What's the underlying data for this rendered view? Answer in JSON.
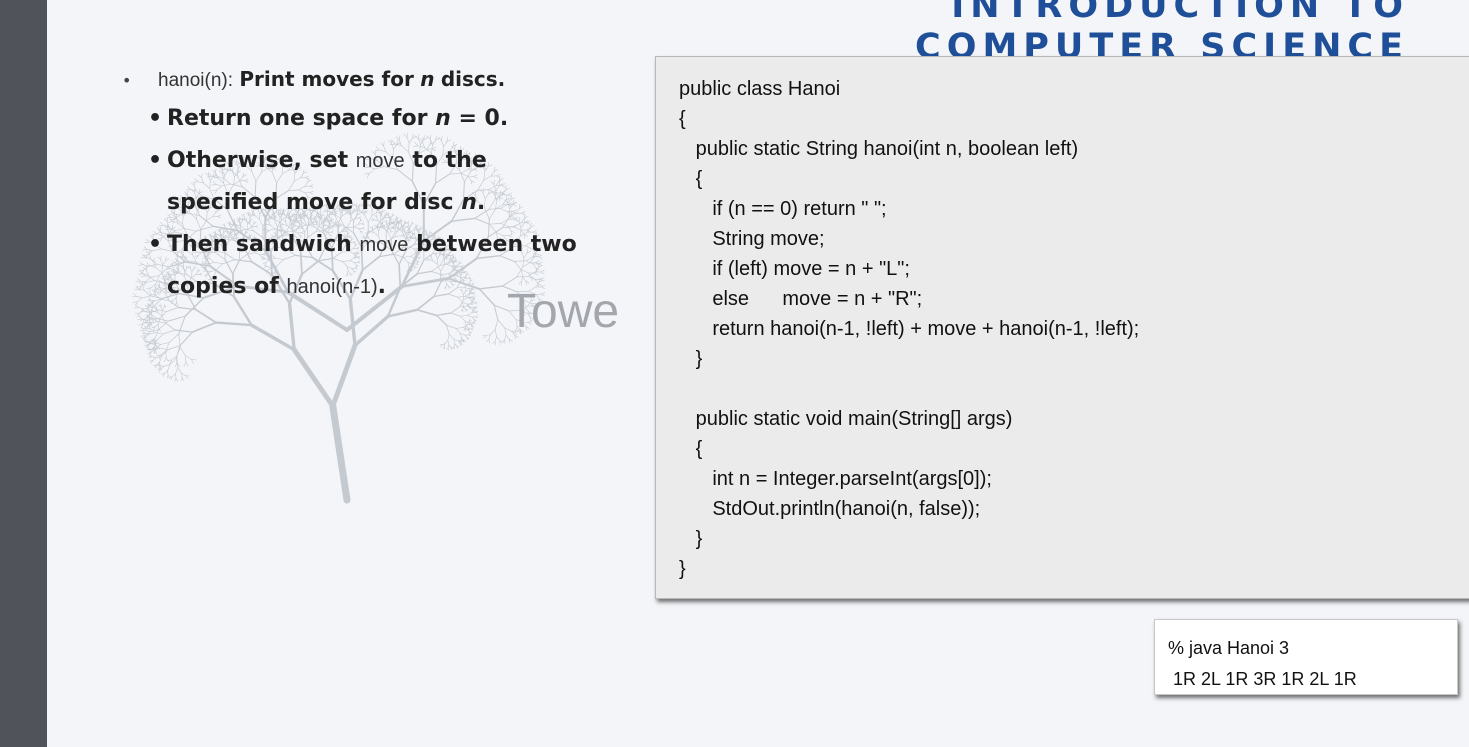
{
  "banner": {
    "line1": "INTRODUCTION TO",
    "line2": "COMPUTER SCIENCE"
  },
  "background_title": "Towe",
  "bullets": {
    "main": {
      "code": "hanoi(n):",
      "text_before": "Print moves for",
      "var": "n",
      "text_after": "discs."
    },
    "sub1": {
      "text": "Return one space for",
      "var": "n",
      "rest": "= 0."
    },
    "sub2": {
      "text1": "Otherwise, set",
      "code": "move",
      "text2": "to the",
      "text3": "specified move for disc",
      "var": "n",
      "end": "."
    },
    "sub3": {
      "text1": "Then sandwich",
      "code1": "move",
      "text2": "between two",
      "text3": "copies of",
      "code2": "hanoi(n-1)",
      "end": "."
    }
  },
  "code": {
    "lines": [
      "public class Hanoi",
      "{",
      "   public static String hanoi(int n, boolean left)",
      "   {",
      "      if (n == 0) return \" \";",
      "      String move;",
      "      if (left) move = n + \"L\";",
      "      else      move = n + \"R\";",
      "      return hanoi(n-1, !left) + move + hanoi(n-1, !left);",
      "   }",
      "",
      "   public static void main(String[] args)",
      "   {",
      "      int n = Integer.parseInt(args[0]);",
      "      StdOut.println(hanoi(n, false));",
      "   }",
      "}"
    ]
  },
  "output": {
    "command": "% java Hanoi 3",
    "result": " 1R 2L 1R 3R 1R 2L 1R"
  }
}
